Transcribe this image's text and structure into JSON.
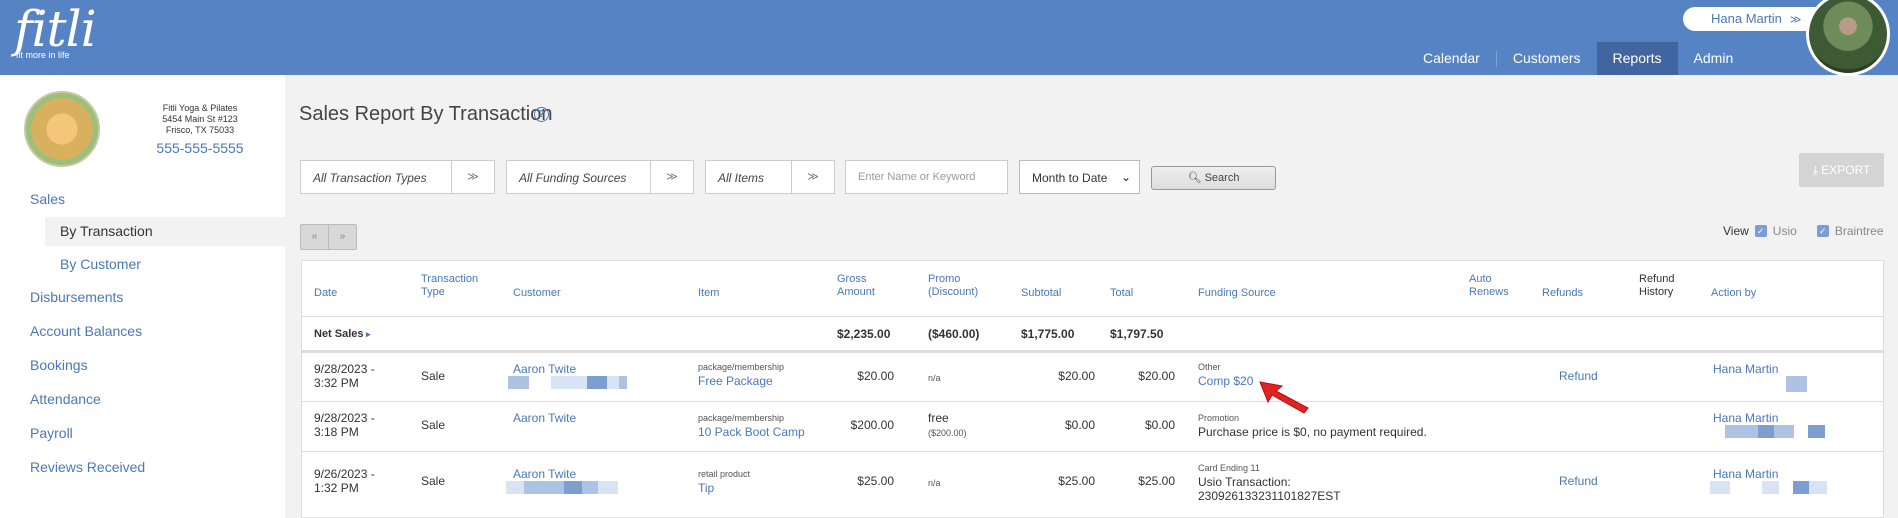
{
  "brand": {
    "logo_text": "fitli",
    "tagline": "fit more in life",
    "accent": "#5583c4"
  },
  "user": {
    "name": "Hana Martin"
  },
  "nav": [
    {
      "label": "Calendar"
    },
    {
      "label": "Customers"
    },
    {
      "label": "Reports",
      "active": true
    },
    {
      "label": "Admin"
    }
  ],
  "business": {
    "name": "Fitli Yoga & Pilates",
    "address1": "5454 Main St #123",
    "address2": "Frisco, TX 75033",
    "phone": "555-555-5555"
  },
  "sidebar": [
    {
      "label": "Sales"
    },
    {
      "label": "By Transaction",
      "active": true
    },
    {
      "label": "By Customer"
    },
    {
      "label": "Disbursements"
    },
    {
      "label": "Account Balances"
    },
    {
      "label": "Bookings"
    },
    {
      "label": "Attendance"
    },
    {
      "label": "Payroll"
    },
    {
      "label": "Reviews Received"
    }
  ],
  "page": {
    "title": "Sales Report By Transaction"
  },
  "filters": {
    "transaction_types": "All Transaction Types",
    "funding_sources": "All Funding Sources",
    "items": "All Items",
    "keyword_placeholder": "Enter Name or Keyword",
    "period": "Month to Date",
    "search_label": "Search",
    "export_label": "EXPORT"
  },
  "pager": {
    "prev": "«",
    "next": "»"
  },
  "view": {
    "label": "View",
    "options": [
      "Usio",
      "Braintree"
    ]
  },
  "columns": {
    "date": "Date",
    "type1": "Transaction",
    "type2": "Type",
    "customer": "Customer",
    "item": "Item",
    "gross1": "Gross",
    "gross2": "Amount",
    "promo1": "Promo",
    "promo2": "(Discount)",
    "subtotal": "Subtotal",
    "total": "Total",
    "funding": "Funding Source",
    "auto1": "Auto",
    "auto2": "Renews",
    "refunds": "Refunds",
    "refund_hist1": "Refund",
    "refund_hist2": "History",
    "action": "Action by"
  },
  "net_sales": {
    "label": "Net Sales",
    "gross": "$2,235.00",
    "promo": "($460.00)",
    "subtotal": "$1,775.00",
    "total": "$1,797.50"
  },
  "rows": [
    {
      "date1": "9/28/2023 -",
      "date2": "3:32 PM",
      "type": "Sale",
      "customer": "Aaron Twite",
      "item_cat": "package/membership",
      "item": "Free Package",
      "gross": "$20.00",
      "promo": "n/a",
      "promo2": "",
      "subtotal": "$20.00",
      "total": "$20.00",
      "fund_cat": "Other",
      "fund": "Comp $20",
      "fund2": "",
      "refund": "Refund",
      "action": "Hana Martin"
    },
    {
      "date1": "9/28/2023 -",
      "date2": "3:18 PM",
      "type": "Sale",
      "customer": "Aaron Twite",
      "item_cat": "package/membership",
      "item": "10 Pack Boot Camp",
      "gross": "$200.00",
      "promo": "free",
      "promo2": "($200.00)",
      "subtotal": "$0.00",
      "total": "$0.00",
      "fund_cat": "Promotion",
      "fund": "Purchase price is $0, no payment required.",
      "fund2": "",
      "refund": "",
      "action": "Hana Martin"
    },
    {
      "date1": "9/26/2023 -",
      "date2": "1:32 PM",
      "type": "Sale",
      "customer": "Aaron Twite",
      "item_cat": "retail product",
      "item": "Tip",
      "gross": "$25.00",
      "promo": "n/a",
      "promo2": "",
      "subtotal": "$25.00",
      "total": "$25.00",
      "fund_cat": "Card Ending 11",
      "fund": "Usio Transaction:",
      "fund2": "230926133231101827EST",
      "refund": "Refund",
      "action": "Hana Martin"
    }
  ]
}
